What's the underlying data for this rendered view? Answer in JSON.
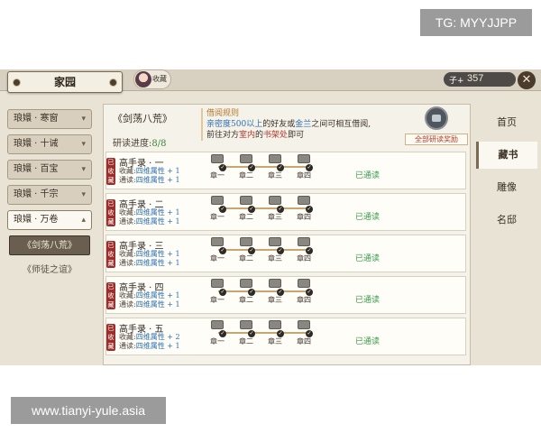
{
  "watermarks": {
    "top": "TG: MYYJJPP",
    "bottom": "www.tianyi-yule.asia"
  },
  "topbar": {
    "home_title": "家园",
    "avatar_label": "收藏",
    "currency_icon": "子+",
    "currency_value": "357"
  },
  "left_menu": [
    {
      "label": "琅嬛 · 寒窗"
    },
    {
      "label": "琅嬛 · 十诫"
    },
    {
      "label": "琅嬛 · 百宝"
    },
    {
      "label": "琅嬛 · 千宗"
    },
    {
      "label": "琅嬛 · 万卷"
    }
  ],
  "left_sub": [
    {
      "label": "《剑荡八荒》"
    },
    {
      "label": "《师徒之谊》"
    }
  ],
  "panel": {
    "book_title": "《剑荡八荒》",
    "progress_label": "研读进度:",
    "progress_value": "8/8",
    "rules_title": "借阅规则",
    "rules_line1_a": "亲密度",
    "rules_line1_b": "500以上",
    "rules_line1_c": "的好友或",
    "rules_line1_d": "金兰",
    "rules_line1_e": "之间可相互借阅,",
    "rules_line2_a": "前往对方",
    "rules_line2_b": "室内",
    "rules_line2_c": "的",
    "rules_line2_d": "书架处",
    "rules_line2_e": "即可",
    "reward_label": "全部研读奖励"
  },
  "rows": [
    {
      "title": "高手录 · 一",
      "stamp": "已收藏",
      "attr1_a": "收藏:",
      "attr1_b": "四维属性 + 1",
      "attr2_a": "通读:",
      "attr2_b": "四维属性 + 1",
      "chapters": [
        "章一",
        "章二",
        "章三",
        "章四"
      ],
      "status": "已通读"
    },
    {
      "title": "高手录 · 二",
      "stamp": "已收藏",
      "attr1_a": "收藏:",
      "attr1_b": "四维属性 + 1",
      "attr2_a": "通读:",
      "attr2_b": "四维属性 + 1",
      "chapters": [
        "章一",
        "章二",
        "章三",
        "章四"
      ],
      "status": "已通读"
    },
    {
      "title": "高手录 · 三",
      "stamp": "已收藏",
      "attr1_a": "收藏:",
      "attr1_b": "四维属性 + 1",
      "attr2_a": "通读:",
      "attr2_b": "四维属性 + 1",
      "chapters": [
        "章一",
        "章二",
        "章三",
        "章四"
      ],
      "status": "已通读"
    },
    {
      "title": "高手录 · 四",
      "stamp": "已收藏",
      "attr1_a": "收藏:",
      "attr1_b": "四维属性 + 1",
      "attr2_a": "通读:",
      "attr2_b": "四维属性 + 1",
      "chapters": [
        "章一",
        "章二",
        "章三",
        "章四"
      ],
      "status": "已通读"
    },
    {
      "title": "高手录 · 五",
      "stamp": "已收藏",
      "attr1_a": "收藏:",
      "attr1_b": "四维属性 + 2",
      "attr2_a": "通读:",
      "attr2_b": "四维属性 + 1",
      "chapters": [
        "章一",
        "章二",
        "章三",
        "章四"
      ],
      "status": "已通读"
    }
  ],
  "right_nav": [
    {
      "label": "首页"
    },
    {
      "label": "藏书"
    },
    {
      "label": "雕像"
    },
    {
      "label": "名邸"
    }
  ],
  "icons": {
    "close": "close-icon",
    "check": "check-icon",
    "chest": "treasure-chest-icon",
    "book": "book-icon"
  }
}
